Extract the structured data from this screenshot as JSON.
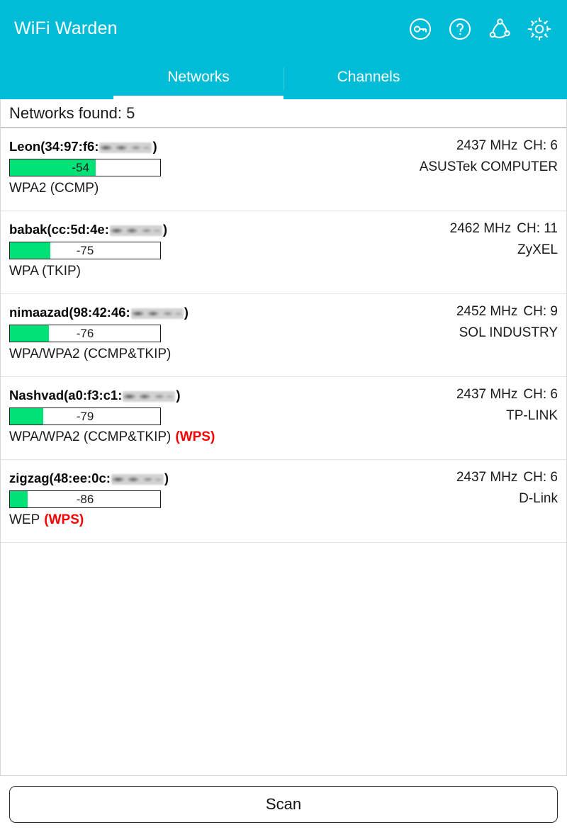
{
  "header": {
    "title": "WiFi Warden",
    "background_color": "#00bcd7",
    "icons": [
      {
        "name": "key-icon",
        "label": "Key"
      },
      {
        "name": "help-icon",
        "label": "Help"
      },
      {
        "name": "network-share-icon",
        "label": "Network"
      },
      {
        "name": "settings-gear-icon",
        "label": "Settings"
      }
    ]
  },
  "tabs": {
    "items": [
      {
        "label": "Networks",
        "active": true
      },
      {
        "label": "Channels",
        "active": false
      }
    ]
  },
  "status": {
    "found_label": "Networks found: 5",
    "count": 5
  },
  "colors": {
    "accent": "#00bcd7",
    "signal_green": "#00e178",
    "wps_red": "#fb0000",
    "text": "#1b1b1b"
  },
  "networks": [
    {
      "ssid": "Leon",
      "bssid_prefix": "(34:97:f6:",
      "bssid_suffix": ")",
      "signal_dbm": "-54",
      "signal_percent": 57,
      "frequency": "2437 MHz",
      "channel": "CH: 6",
      "vendor": "ASUSTek COMPUTER",
      "security": "WPA2 (CCMP)",
      "wps": ""
    },
    {
      "ssid": "babak",
      "bssid_prefix": "(cc:5d:4e:",
      "bssid_suffix": ")",
      "signal_dbm": "-75",
      "signal_percent": 27,
      "frequency": "2462 MHz",
      "channel": "CH: 11",
      "vendor": "ZyXEL",
      "security": "WPA (TKIP)",
      "wps": ""
    },
    {
      "ssid": "nimaazad",
      "bssid_prefix": "(98:42:46:",
      "bssid_suffix": ")",
      "signal_dbm": "-76",
      "signal_percent": 26,
      "frequency": "2452 MHz",
      "channel": "CH: 9",
      "vendor": "SOL INDUSTRY",
      "security": "WPA/WPA2 (CCMP&TKIP)",
      "wps": ""
    },
    {
      "ssid": "Nashvad",
      "bssid_prefix": "(a0:f3:c1:",
      "bssid_suffix": ")",
      "signal_dbm": "-79",
      "signal_percent": 22,
      "frequency": "2437 MHz",
      "channel": "CH: 6",
      "vendor": "TP-LINK",
      "security": "WPA/WPA2 (CCMP&TKIP)",
      "wps": "(WPS)"
    },
    {
      "ssid": "zigzag",
      "bssid_prefix": "(48:ee:0c:",
      "bssid_suffix": ")",
      "signal_dbm": "-86",
      "signal_percent": 12,
      "frequency": "2437 MHz",
      "channel": "CH: 6",
      "vendor": "D-Link",
      "security": "WEP",
      "wps": "(WPS)"
    }
  ],
  "footer": {
    "scan_label": "Scan"
  }
}
